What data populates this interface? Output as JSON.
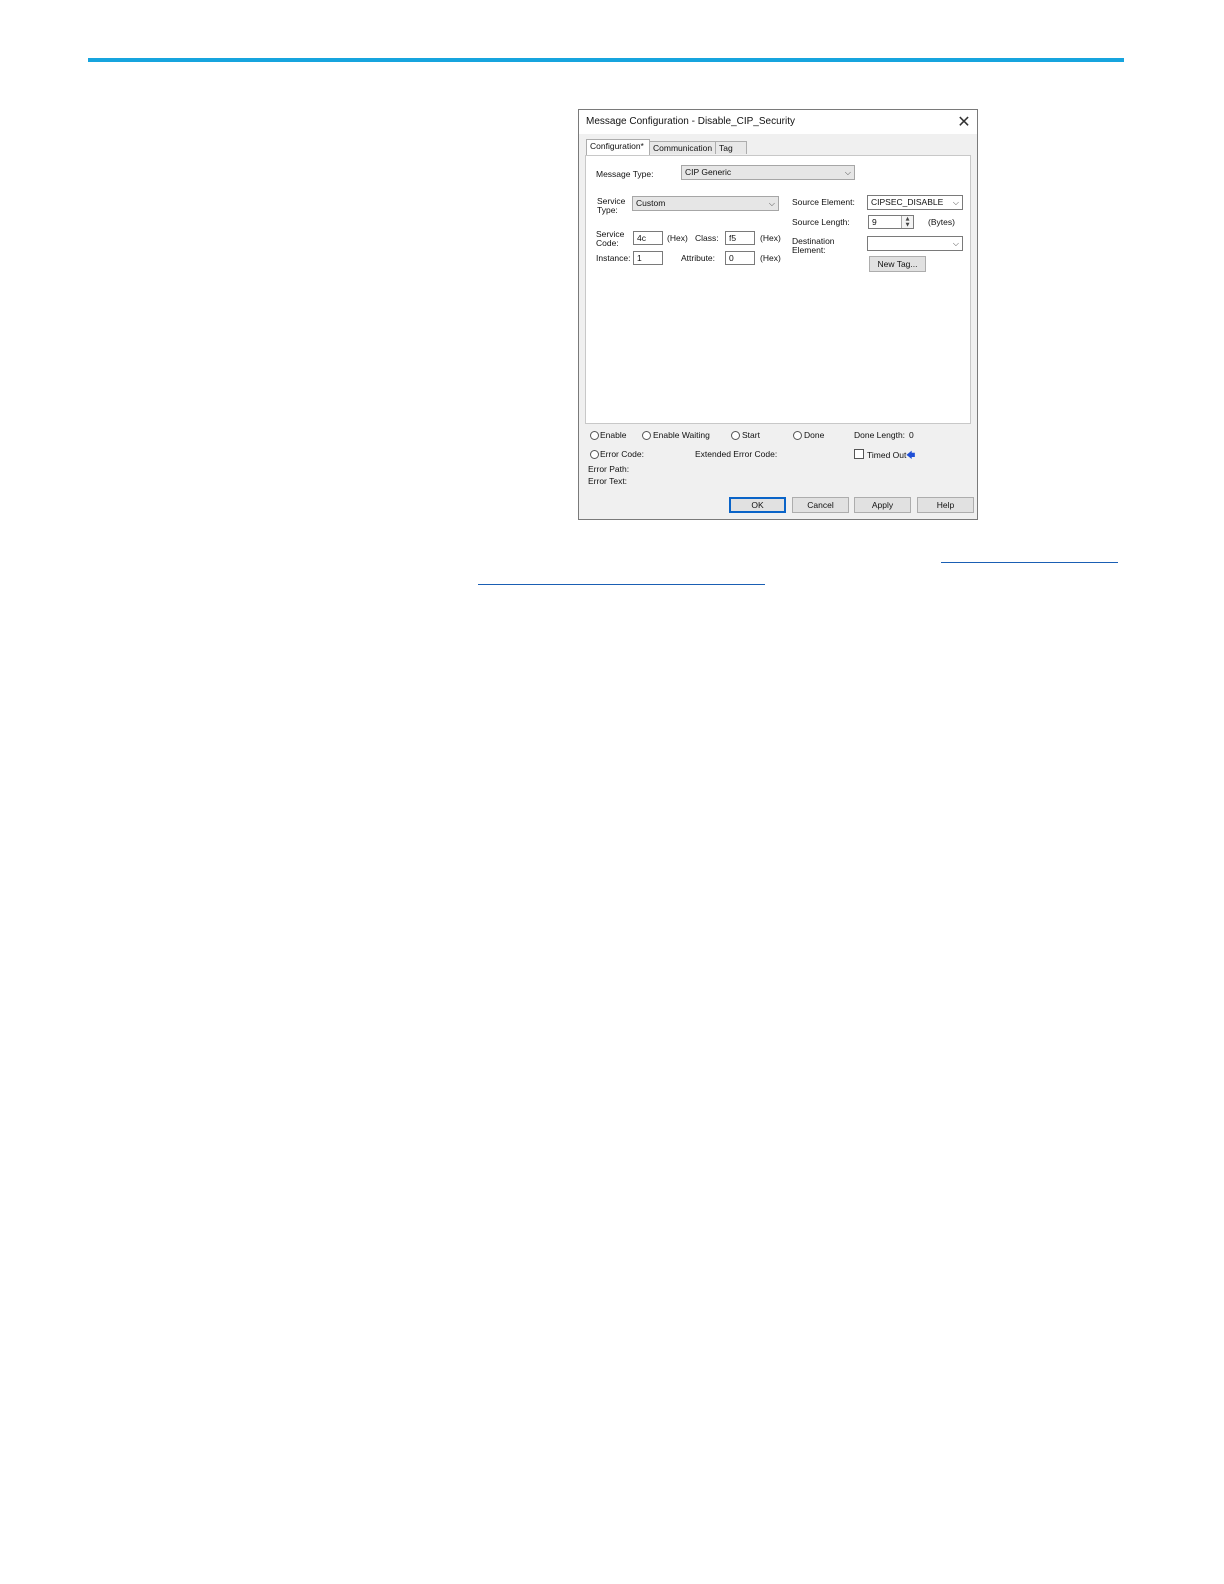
{
  "dialog": {
    "title": "Message Configuration - Disable_CIP_Security",
    "close_symbol": "✕",
    "tabs": [
      {
        "label": "Configuration*"
      },
      {
        "label": "Communication"
      },
      {
        "label": "Tag"
      }
    ],
    "message_type": {
      "label": "Message Type:",
      "value": "CIP Generic"
    },
    "service_type": {
      "label": "Service Type:",
      "value": "Custom"
    },
    "service_code": {
      "label": "Service Code:",
      "value": "4c",
      "unit": "(Hex)"
    },
    "class": {
      "label": "Class:",
      "value": "f5",
      "unit": "(Hex)"
    },
    "instance": {
      "label": "Instance:",
      "value": "1"
    },
    "attribute": {
      "label": "Attribute:",
      "value": "0",
      "unit": "(Hex)"
    },
    "source_element": {
      "label": "Source Element:",
      "value": "CIPSEC_DISABLE"
    },
    "source_length": {
      "label": "Source Length:",
      "value": "9",
      "unit": "(Bytes)"
    },
    "destination_element": {
      "label": "Destination Element:",
      "value": ""
    },
    "new_tag_button": "New Tag...",
    "status": {
      "enable": "Enable",
      "enable_waiting": "Enable Waiting",
      "start": "Start",
      "done": "Done",
      "done_length_label": "Done Length:",
      "done_length_value": "0",
      "error_code": "Error Code:",
      "extended_error_code": "Extended Error Code:",
      "timed_out": "Timed Out",
      "timed_out_icon": "arrow-left-icon",
      "error_path": "Error Path:",
      "error_text": "Error Text:"
    },
    "buttons": {
      "ok": "OK",
      "cancel": "Cancel",
      "apply": "Apply",
      "help": "Help"
    }
  },
  "colors": {
    "accent_rule": "#16a4de",
    "link": "#1a5fb4",
    "default_button_border": "#0a64c8"
  }
}
